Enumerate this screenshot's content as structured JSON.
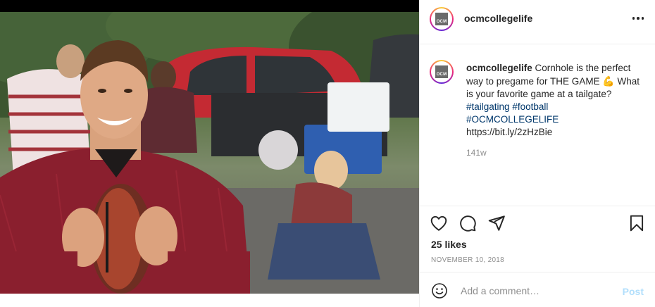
{
  "post": {
    "username": "ocmcollegelife",
    "avatar_logo_text": "OCM",
    "image_alt": "Smiling man in a maroon jersey holding a football at a tailgate party",
    "caption": {
      "username": "ocmcollegelife",
      "text_1": " Cornhole is the perfect way to pregame for THE GAME ",
      "emoji": "💪",
      "text_2": " What is your favorite game at a tailgate? ",
      "hashtag_1": "#tailgating",
      "hashtag_2": "#football",
      "hashtag_3": "#OCMCOLLEGELIFE",
      "link": "https://bit.ly/2zHzBie"
    },
    "time_ago": "141w",
    "likes": "25 likes",
    "date": "NOVEMBER 10, 2018"
  },
  "comment_box": {
    "placeholder": "Add a comment…",
    "post_label": "Post"
  },
  "icons": [
    "more-icon",
    "heart-icon",
    "comment-icon",
    "share-icon",
    "bookmark-icon",
    "smile-icon"
  ],
  "colors": {
    "hashtag": "#00376b",
    "post_button_disabled": "#b2dffc",
    "muted_text": "#8e8e8e"
  }
}
